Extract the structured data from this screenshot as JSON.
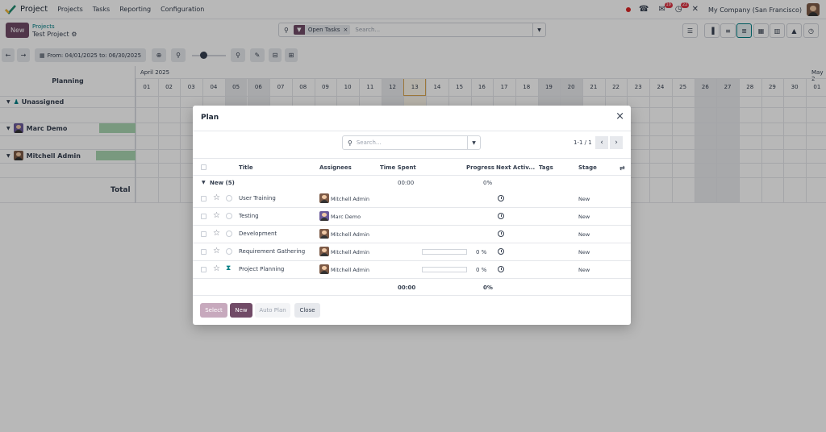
{
  "app": {
    "name": "Project"
  },
  "menu": [
    "Projects",
    "Tasks",
    "Reporting",
    "Configuration"
  ],
  "systray": {
    "chat_badge": "19",
    "activity_badge": "22",
    "company": "My Company (San Francisco)"
  },
  "control": {
    "new_label": "New",
    "breadcrumb_parent": "Projects",
    "breadcrumb_current": "Test Project",
    "facet_label": "Open Tasks",
    "search_placeholder": "Search..."
  },
  "gantt_toolbar": {
    "date_range": "From: 04/01/2025 to: 06/30/2025"
  },
  "gantt": {
    "planning_title": "Planning",
    "month_label": "April 2025",
    "next_month_label": "May 2",
    "days": [
      "01",
      "02",
      "03",
      "04",
      "05",
      "06",
      "07",
      "08",
      "09",
      "10",
      "11",
      "12",
      "13",
      "14",
      "15",
      "16",
      "17",
      "18",
      "19",
      "20",
      "21",
      "22",
      "23",
      "24",
      "25",
      "26",
      "27",
      "28",
      "29",
      "30",
      "01"
    ],
    "rows": [
      {
        "label": "Unassigned"
      },
      {
        "label": "Marc Demo"
      },
      {
        "label": "Mitchell Admin"
      }
    ],
    "total_label": "Total"
  },
  "dialog": {
    "title": "Plan",
    "search_placeholder": "Search...",
    "pager": "1-1 / 1",
    "columns": {
      "title": "Title",
      "assignees": "Assignees",
      "time_spent": "Time Spent",
      "progress": "Progress",
      "next_activity": "Next Activ...",
      "tags": "Tags",
      "stage": "Stage"
    },
    "group": {
      "label": "New (5)",
      "time_spent": "00:00",
      "progress": "0%"
    },
    "rows": [
      {
        "title": "User Training",
        "assignee": "Mitchell Admin",
        "progress": "",
        "stage": "New"
      },
      {
        "title": "Testing",
        "assignee": "Marc Demo",
        "progress": "",
        "stage": "New"
      },
      {
        "title": "Development",
        "assignee": "Mitchell Admin",
        "progress": "",
        "stage": "New"
      },
      {
        "title": "Requirement Gathering",
        "assignee": "Mitchell Admin",
        "progress": "0 %",
        "stage": "New"
      },
      {
        "title": "Project Planning",
        "assignee": "Mitchell Admin",
        "progress": "0 %",
        "stage": "New"
      }
    ],
    "totals": {
      "time_spent": "00:00",
      "progress": "0%"
    },
    "buttons": {
      "select": "Select",
      "new": "New",
      "auto_plan": "Auto Plan",
      "close": "Close"
    }
  },
  "colors": {
    "brand": "#714b67",
    "teal": "#017e84",
    "weekend": "#e9ebee",
    "green_bar": "#a8d5b0"
  },
  "icons": [
    "project-logo-icon",
    "phone-icon",
    "chat-icon",
    "clock-activity-icon",
    "tools-icon",
    "search-icon",
    "filter-icon",
    "gear-icon",
    "kanban-icon",
    "list-icon",
    "gantt-icon",
    "calendar-icon",
    "pivot-icon",
    "graph-icon",
    "activity-icon",
    "star-icon",
    "hourglass-icon",
    "close-icon"
  ]
}
